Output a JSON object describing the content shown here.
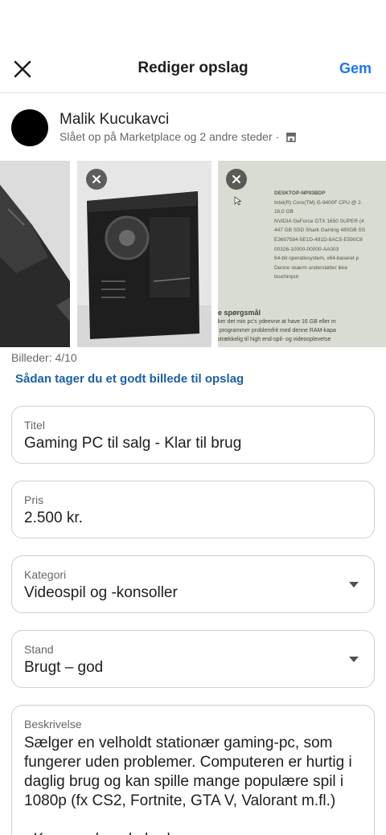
{
  "header": {
    "title": "Rediger opslag",
    "save_label": "Gem"
  },
  "profile": {
    "name": "Malik Kucukavci",
    "posted_in": "Slået op på Marketplace og 2 andre steder ·"
  },
  "photos": {
    "count_label": "Billeder: 4/10",
    "tip_link": "Sådan tager du et godt billede til opslag",
    "screen_lines": [
      "DESKTOP-NP93BDP",
      "Intel(R) Core(TM) i5-9400F CPU @ 2.",
      "16,0 GB",
      "NVIDIA GeForce GTX 1650 SUPER (4",
      "447 GB SSD Shark Gaming 480GB SS",
      "E3607584-5E1D-481D-8AC5-E590C8",
      "00326-10000-00000-AA003",
      "64-bit operativsystem, x64-baseret p",
      "Denne skærm understøtter ikke",
      "touchinput"
    ],
    "screen_bottom_lines": [
      "e spørgsmål",
      "irker det min pc's ydeevne at have 16 GB eller m",
      "e programmer problemfrit med denne RAM-kapa",
      "ilstrækkelig til high end-spil- og videoopleveIse"
    ]
  },
  "form": {
    "title": {
      "label": "Titel",
      "value": "Gaming PC til salg - Klar til brug"
    },
    "price": {
      "label": "Pris",
      "value": "2.500 kr."
    },
    "category": {
      "label": "Kategori",
      "value": "Videospil og -konsoller"
    },
    "condition": {
      "label": "Stand",
      "value": "Brugt – god"
    },
    "description": {
      "label": "Beskrivelse",
      "value": "Sælger en velholdt stationær gaming-pc, som fungerer uden problemer. Computeren er hurtig i daglig brug og kan spille mange populære spil i 1080p (fx CS2, Fortnite, GTA V, Valorant m.fl.)\n\n- Kom med nogle bud"
    }
  },
  "icons": {
    "close": "close-icon",
    "remove_photo": "remove-photo-icon",
    "shop": "shop-icon",
    "caret": "caret-down-icon"
  }
}
